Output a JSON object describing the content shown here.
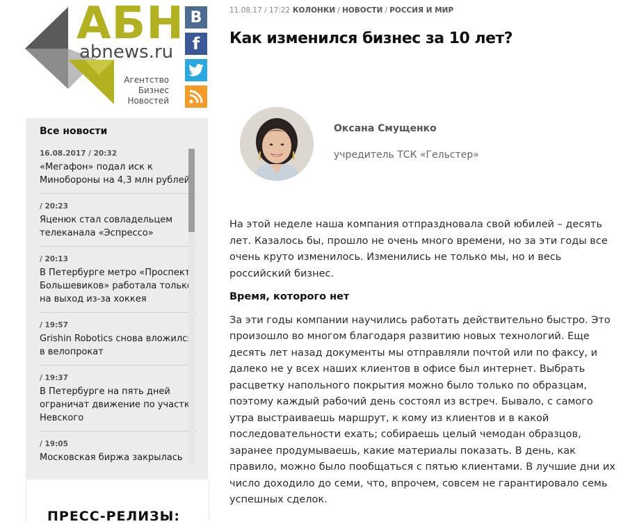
{
  "logo": {
    "abbr": "АБН",
    "site": "abnews.ru",
    "tagline": [
      "Агентство",
      "Бизнес",
      "Новостей"
    ],
    "colors": {
      "olive": "#b2b120",
      "dark": "#555555",
      "gray": "#8c8c8c",
      "light": "#bfbfbf"
    }
  },
  "social": [
    {
      "name": "vk",
      "glyph": "В",
      "color": "#4c6c91"
    },
    {
      "name": "facebook",
      "glyph": "f",
      "color": "#3b5998"
    },
    {
      "name": "twitter",
      "glyph": "twitter-bird-icon",
      "color": "#29a9e1"
    },
    {
      "name": "rss",
      "glyph": "rss-icon",
      "color": "#f49a27"
    }
  ],
  "sidebar": {
    "title": "Все новости",
    "items": [
      {
        "time": "16.08.2017 / 20:32",
        "text": "«Мегафон» подал иск к Минобороны на 4,3 млн рублей"
      },
      {
        "time": "/ 20:23",
        "text": "Яценюк стал совладельцем телеканала «Эспрессо»"
      },
      {
        "time": "/ 20:13",
        "text": "В Петербурге метро «Проспект Большевиков» работала только на выход из-за хоккея"
      },
      {
        "time": "/ 19:57",
        "text": "Grishin Robotics снова вложился в велопрокат"
      },
      {
        "time": "/ 19:37",
        "text": "В Петербурге на пять дней ограничат движение по участку Невского"
      },
      {
        "time": "/ 19:05",
        "text": "Московская биржа закрылась"
      }
    ],
    "press_title": "ПРЕСС-РЕЛИЗЫ:"
  },
  "article": {
    "meta": {
      "date": "11.08.17 / 17:22",
      "categories": [
        "КОЛОНКИ",
        "НОВОСТИ",
        "РОССИЯ И МИР"
      ]
    },
    "title": "Как изменился бизнес за 10 лет?",
    "author": {
      "name": "Оксана Смущенко",
      "role": "учредитель ТСК «Гельстер»"
    },
    "intro": "На этой неделе наша компания отпраздновала свой юбилей – десять лет. Казалось бы, прошло не очень много времени, но за эти годы все очень круто изменилось. Изменились не только мы, но и весь российский бизнес.",
    "subheading": "Время, которого нет",
    "paragraph2": "За эти годы компании научились работать действительно быстро. Это произошло во многом благодаря развитию новых технологий. Еще десять лет назад документы мы отправляли почтой или по факсу, и далеко не у всех наших клиентов в офисе был интернет. Выбрать расцветку напольного покрытия можно было только по образцам, поэтому каждый рабочий день состоял из встреч. Бывало, с самого утра выстраиваешь маршрут, к кому из клиентов и в какой последовательности ехать; собираешь целый чемодан образцов, заранее продумываешь, какие материалы показать. В день, как правило, можно было пообщаться с пятью клиентами. В лучшие дни их число доходило до семи, что, впрочем, совсем не гарантировало семь успешных сделок."
  }
}
